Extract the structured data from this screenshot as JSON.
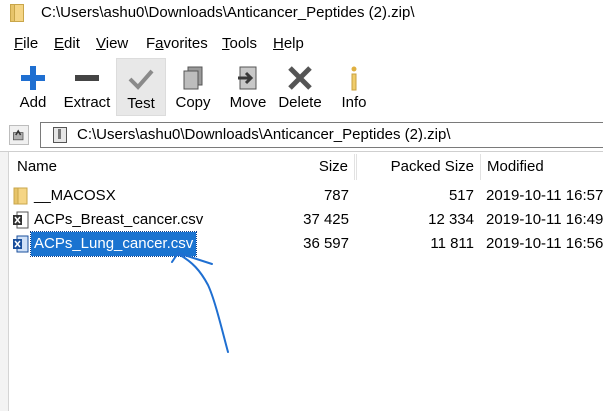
{
  "window": {
    "title": "C:\\Users\\ashu0\\Downloads\\Anticancer_Peptides (2).zip\\"
  },
  "menu": [
    {
      "label": "File",
      "underline": "F"
    },
    {
      "label": "Edit",
      "underline": "E"
    },
    {
      "label": "View",
      "underline": "V"
    },
    {
      "label": "Favorites",
      "underline": "a"
    },
    {
      "label": "Tools",
      "underline": "T"
    },
    {
      "label": "Help",
      "underline": "H"
    }
  ],
  "toolbar": {
    "add": "Add",
    "extract": "Extract",
    "test": "Test",
    "copy": "Copy",
    "move": "Move",
    "delete": "Delete",
    "info": "Info"
  },
  "address": {
    "path": "C:\\Users\\ashu0\\Downloads\\Anticancer_Peptides (2).zip\\"
  },
  "columns": {
    "name": "Name",
    "size": "Size",
    "packed": "Packed Size",
    "modified": "Modified"
  },
  "files": [
    {
      "name": "__MACOSX",
      "size": "787",
      "packed": "517",
      "modified": "2019-10-11 16:57",
      "icon": "folder-icon",
      "selected": false
    },
    {
      "name": "ACPs_Breast_cancer.csv",
      "size": "37 425",
      "packed": "12 334",
      "modified": "2019-10-11 16:49",
      "icon": "csv-file-icon",
      "selected": false
    },
    {
      "name": "ACPs_Lung_cancer.csv",
      "size": "36 597",
      "packed": "11 811",
      "modified": "2019-10-11 16:56",
      "icon": "csv-file-icon",
      "selected": true
    }
  ],
  "colors": {
    "add_blue": "#1f6fd1",
    "selection": "#1a73d0",
    "annotation_ink": "#1f6fd1",
    "delete_dark": "#555555"
  }
}
